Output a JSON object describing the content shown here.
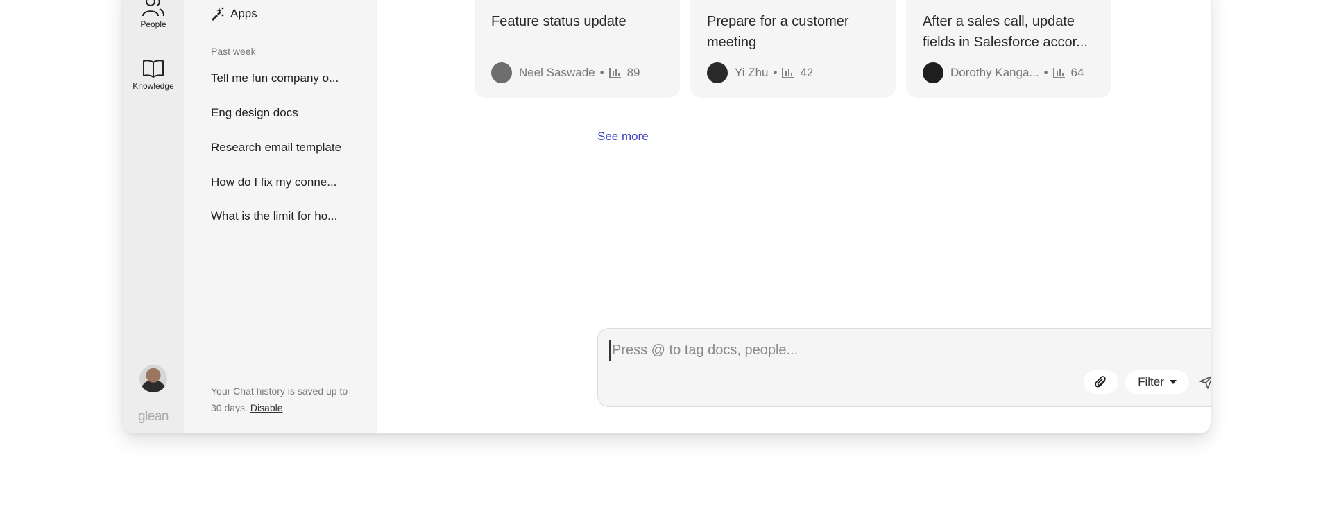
{
  "rail": {
    "people_label": "People",
    "knowledge_label": "Knowledge",
    "brand": "glean"
  },
  "sidebar": {
    "apps_label": "Apps",
    "section_label": "Past week",
    "history": [
      "Tell me fun company o...",
      "Eng design docs",
      "Research email template",
      "How do I fix my conne...",
      "What is the limit for ho..."
    ],
    "notice_text": "Your Chat history is saved up to 30 days.",
    "notice_link": "Disable"
  },
  "cards": [
    {
      "title": "Feature status update",
      "author": "Neel Saswade",
      "count": "89"
    },
    {
      "title": "Prepare for a customer meeting",
      "author": "Yi Zhu",
      "count": "42"
    },
    {
      "title": "After a sales call, update fields in Salesforce accor...",
      "author": "Dorothy Kanga...",
      "count": "64"
    }
  ],
  "see_more": "See more",
  "composer": {
    "placeholder": "Press @ to tag docs, people...",
    "filter_label": "Filter"
  },
  "colors": {
    "accent_link": "#3b3fc2",
    "rail_bg": "#ededed",
    "sidebar_bg": "#f5f5f5"
  },
  "icons": [
    "people-icon",
    "book-icon",
    "apps-icon",
    "bar-chart-icon",
    "paperclip-icon",
    "caret-down-icon",
    "send-icon"
  ]
}
